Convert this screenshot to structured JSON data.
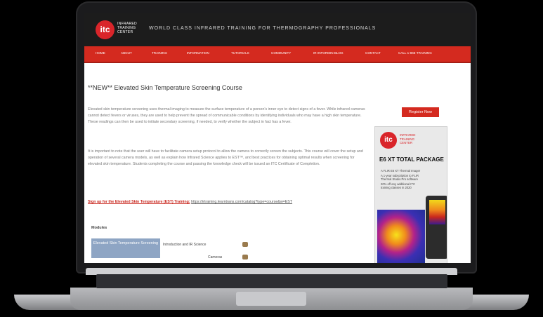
{
  "header": {
    "logo_mark": "itc",
    "logo_text": "INFRARED TRAINING CENTER",
    "tagline": "WORLD CLASS INFRARED TRAINING FOR THERMOGRAPHY PROFESSIONALS"
  },
  "nav": {
    "items": [
      "HOME",
      "ABOUT",
      "TRAINING",
      "INFORMATION",
      "TUTORIALS",
      "COMMUNITY",
      "IR INFORMIN BLOG",
      "CONTACT",
      "CALL 1-866-TRAINING"
    ]
  },
  "page": {
    "title": "**NEW** Elevated Skin Temperature Screening Course",
    "para1": "Elevated skin temperature screening uses thermal imaging to measure the surface temperature of a person's inner eye to detect signs of a fever. While infrared cameras cannot detect fevers or viruses, they are used to help prevent the spread of communicable conditions by identifying individuals who may have a high skin temperature. These readings can then be used to initiate secondary screening, if needed, to verify whether the subject in fact has a fever.",
    "para2": "It is important to note that the user will have to facilitate camera setup protocol to allow the camera to correctly screen the subjects. This course will cover the setup and operation of several camera models, as well as explain how Infrared Science applies to EST™, and best practices for obtaining optimal results when screening for elevated skin temperature. Students completing the course and passing the knowledge check will be issued an ITC Certificate of Completion.",
    "signup_link": "Sign up for the Elevated Skin Temperature (EST) Training:",
    "signup_url": "https://irtraining.learntrans.com/catalog?type=course&w=EST",
    "modules_label": "Modules",
    "video_title": "Elevated Skin Temperature Screening",
    "modules": [
      "Introduction and IR Science",
      "Cameras"
    ]
  },
  "sidebar": {
    "register_label": "Register Now",
    "ad_logo_mark": "itc",
    "ad_logo_text": "INFRARED TRAINING CENTER",
    "ad_title": "E6 XT TOTAL PACKAGE",
    "ad_bullets": [
      "A FLIR E6 XT Thermal Imager",
      "A 1-year subscription to FLIR Thermal Studio Pro software",
      "20% off any additional ITC training classes in 2020"
    ]
  },
  "colors": {
    "brand_red": "#d42a1f",
    "header_dark": "#1c1c1c"
  }
}
